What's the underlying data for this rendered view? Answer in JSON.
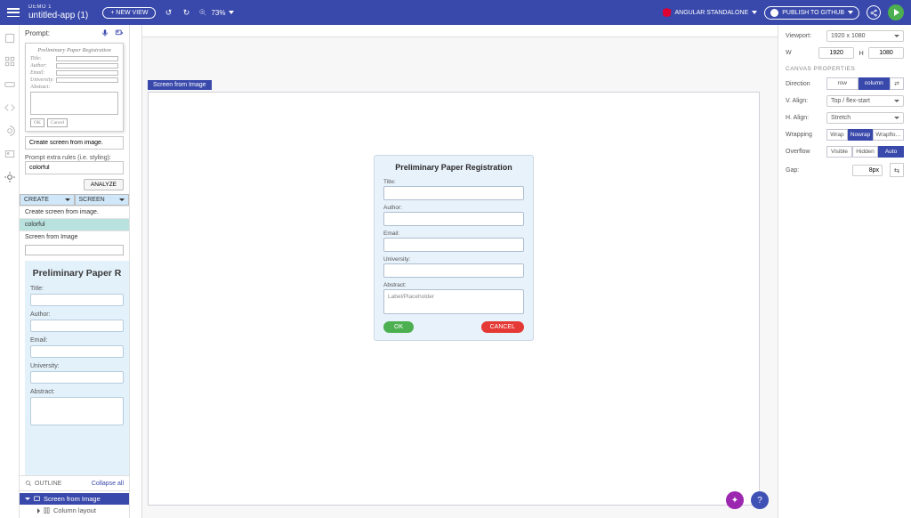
{
  "topbar": {
    "demo_label": "DEMO 1",
    "app_name": "untitled-app (1)",
    "new_view": "+ NEW VIEW",
    "zoom": "73%",
    "standalone": "ANGULAR STANDALONE",
    "publish": "PUBLISH TO GITHUB"
  },
  "left": {
    "prompt_label": "Prompt:",
    "sketch": {
      "title": "Preliminary Paper Registration",
      "rows": [
        "Title:",
        "Author:",
        "Email:",
        "University:",
        "Abstract:"
      ],
      "ok": "OK",
      "cancel": "Cancel"
    },
    "prompt_input": "Create screen from image.",
    "extra_label": "Prompt extra rules (i.e. styling):",
    "extra_input": "colorful",
    "analyze": "ANALYZE",
    "dd_create": "CREATE",
    "dd_screen": "SCREEN",
    "history": [
      "Create screen from image.",
      "colorful",
      "Screen from Image"
    ],
    "preview": {
      "title": "Preliminary Paper R",
      "labels": {
        "title": "Title:",
        "author": "Author:",
        "email": "Email:",
        "university": "University:",
        "abstract": "Abstract:"
      }
    },
    "outline": "OUTLINE",
    "collapse_all": "Collapse all",
    "tree": {
      "root": "Screen from Image",
      "child": "Column layout"
    }
  },
  "canvas": {
    "label": "Screen from Image",
    "form": {
      "title": "Preliminary Paper Registration",
      "labels": {
        "title": "Title:",
        "author": "Author:",
        "email": "Email:",
        "university": "University:",
        "abstract": "Abstract:"
      },
      "abstract_placeholder": "Label/Placeholder",
      "ok": "OK",
      "cancel": "CANCEL"
    },
    "fab_ai": "✦",
    "fab_help": "?"
  },
  "right": {
    "viewport_label": "Viewport:",
    "viewport_value": "1920 x 1080",
    "w": "W",
    "w_val": "1920",
    "h": "H",
    "h_val": "1080",
    "section": "CANVAS PROPERTIES",
    "direction": "Direction",
    "dir_row": "row",
    "dir_col": "column",
    "valign_label": "V. Align:",
    "valign_value": "Top / flex-start",
    "halign_label": "H. Align:",
    "halign_value": "Stretch",
    "wrapping": "Wrapping",
    "wrap": "Wrap",
    "nowrap": "Nowrap",
    "wrapflow": "Wrapflo…",
    "overflow": "Overflow",
    "visible": "Visible",
    "hidden": "Hidden",
    "auto": "Auto",
    "gap_label": "Gap:",
    "gap_value": "8px"
  }
}
